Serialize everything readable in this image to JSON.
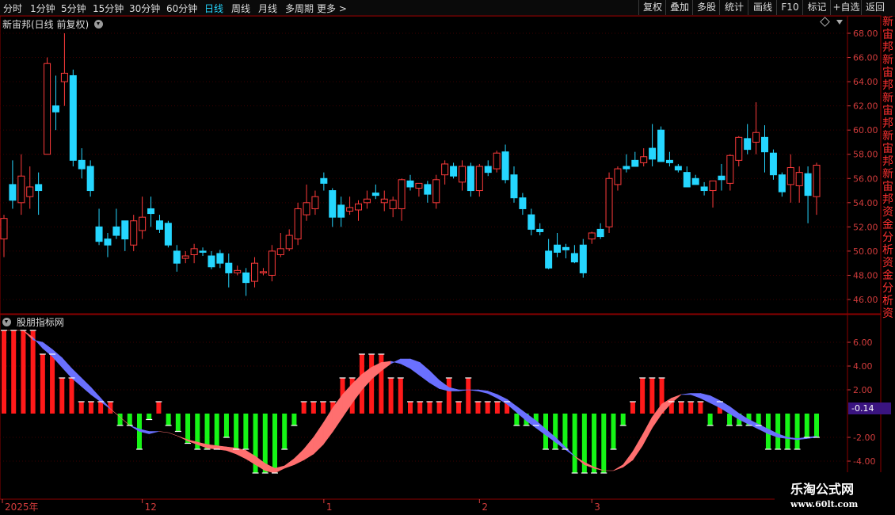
{
  "toolbar": {
    "tabs": [
      "分时",
      "1分钟",
      "5分钟",
      "15分钟",
      "30分钟",
      "60分钟",
      "日线",
      "周线",
      "月线",
      "多周期",
      "更多 >"
    ],
    "active_tab": "日线",
    "buttons": [
      "复权",
      "叠加",
      "多股",
      "统计",
      "画线",
      "F10",
      "标记",
      "+自选",
      "返回"
    ]
  },
  "price_panel": {
    "title": "新宙邦(日线 前复权)"
  },
  "indicator_panel": {
    "title": "股朋指标网",
    "current_value": "-0.14"
  },
  "watermark": {
    "line1": "乐淘公式网",
    "line2": "www.60lt.com"
  },
  "edge_glyphs": [
    "新",
    "宙",
    "邦",
    "新",
    "宙",
    "邦",
    "新",
    "宙",
    "邦",
    "新",
    "宙",
    "邦",
    "新",
    "宙",
    "邦",
    "资",
    "金",
    "分",
    "析",
    "资",
    "金",
    "分",
    "析",
    "资"
  ],
  "colors": {
    "up": "#ff3b3b",
    "down": "#25d6ff",
    "hist_pos": "#ff1a1a",
    "hist_neg": "#16f516",
    "ribbon_up": "#ff6f6f",
    "ribbon_down": "#6a70ff",
    "axis": "#8b0000",
    "axis_text": "#d23c3c"
  },
  "chart_data": [
    {
      "type": "candlestick",
      "title": "新宙邦(日线 前复权)",
      "ylim": [
        45.0,
        69.0
      ],
      "yticks": [
        "46.00",
        "48.00",
        "50.00",
        "52.00",
        "54.00",
        "56.00",
        "58.00",
        "60.00",
        "62.00",
        "64.00",
        "66.00",
        "68.00"
      ],
      "xticks": [
        "2025年",
        "12",
        "1",
        "2",
        "3"
      ],
      "xtick_index": [
        0,
        16,
        37,
        55,
        68
      ],
      "candles": [
        [
          51.0,
          53.0,
          49.5,
          52.7
        ],
        [
          55.5,
          57.5,
          53.5,
          54.2
        ],
        [
          54.0,
          58.0,
          53.0,
          56.2
        ],
        [
          54.5,
          57.0,
          53.5,
          55.3
        ],
        [
          55.5,
          56.5,
          53.0,
          55.0
        ],
        [
          58.0,
          66.0,
          58.0,
          65.5
        ],
        [
          62.0,
          64.5,
          60.0,
          61.5
        ],
        [
          64.0,
          68.0,
          62.0,
          64.7
        ],
        [
          64.5,
          65.0,
          57.0,
          57.5
        ],
        [
          57.5,
          58.5,
          56.0,
          56.8
        ],
        [
          57.0,
          57.5,
          54.5,
          55.0
        ],
        [
          52.0,
          53.5,
          50.5,
          50.8
        ],
        [
          51.0,
          51.5,
          49.5,
          50.5
        ],
        [
          52.0,
          53.5,
          51.0,
          51.3
        ],
        [
          52.5,
          52.5,
          50.0,
          51.0
        ],
        [
          50.5,
          53.0,
          50.0,
          52.5
        ],
        [
          51.7,
          54.5,
          51.0,
          52.8
        ],
        [
          53.5,
          54.5,
          52.0,
          53.1
        ],
        [
          52.5,
          53.0,
          51.5,
          51.8
        ],
        [
          52.3,
          52.5,
          50.3,
          50.5
        ],
        [
          50.0,
          50.5,
          48.3,
          49.0
        ],
        [
          49.4,
          50.0,
          49.0,
          49.6
        ],
        [
          49.7,
          50.6,
          49.0,
          50.2
        ],
        [
          50.0,
          50.3,
          49.6,
          49.9
        ],
        [
          49.6,
          50.0,
          48.5,
          48.7
        ],
        [
          49.8,
          50.1,
          48.6,
          49.0
        ],
        [
          49.0,
          49.8,
          47.0,
          48.2
        ],
        [
          48.2,
          48.8,
          48.0,
          48.4
        ],
        [
          48.2,
          48.6,
          46.3,
          47.4
        ],
        [
          47.5,
          49.5,
          47.0,
          49.0
        ],
        [
          48.2,
          48.6,
          48.0,
          48.3
        ],
        [
          48.0,
          50.5,
          47.5,
          50.0
        ],
        [
          49.7,
          51.5,
          49.5,
          50.2
        ],
        [
          50.2,
          51.8,
          50.0,
          51.3
        ],
        [
          51.0,
          54.0,
          50.5,
          53.5
        ],
        [
          53.0,
          55.5,
          52.5,
          54.0
        ],
        [
          53.5,
          55.0,
          53.0,
          54.5
        ],
        [
          56.0,
          56.5,
          55.0,
          55.6
        ],
        [
          55.0,
          55.2,
          52.0,
          52.8
        ],
        [
          53.8,
          54.5,
          52.0,
          52.8
        ],
        [
          53.3,
          54.5,
          53.0,
          53.6
        ],
        [
          53.4,
          54.2,
          52.5,
          53.9
        ],
        [
          54.0,
          55.0,
          53.5,
          54.3
        ],
        [
          54.8,
          55.5,
          54.3,
          54.6
        ],
        [
          54.0,
          55.0,
          53.3,
          54.3
        ],
        [
          53.5,
          54.5,
          52.8,
          54.2
        ],
        [
          53.5,
          56.0,
          52.5,
          55.9
        ],
        [
          55.8,
          56.3,
          55.0,
          55.3
        ],
        [
          55.2,
          55.6,
          54.5,
          55.6
        ],
        [
          55.5,
          55.8,
          54.0,
          54.7
        ],
        [
          54.0,
          56.3,
          53.5,
          55.9
        ],
        [
          56.3,
          57.5,
          55.5,
          57.2
        ],
        [
          57.0,
          57.3,
          56.0,
          56.2
        ],
        [
          55.7,
          57.5,
          55.0,
          57.0
        ],
        [
          57.0,
          57.3,
          54.5,
          55.0
        ],
        [
          55.0,
          57.2,
          54.5,
          57.0
        ],
        [
          57.0,
          57.5,
          56.2,
          56.5
        ],
        [
          56.8,
          58.3,
          56.5,
          58.1
        ],
        [
          58.2,
          58.8,
          55.6,
          55.9
        ],
        [
          56.3,
          57.0,
          54.0,
          54.4
        ],
        [
          54.4,
          54.8,
          53.0,
          53.5
        ],
        [
          53.0,
          53.5,
          51.3,
          51.8
        ],
        [
          51.8,
          52.3,
          51.3,
          51.6
        ],
        [
          50.0,
          51.0,
          48.5,
          48.6
        ],
        [
          50.5,
          51.5,
          49.5,
          49.9
        ],
        [
          50.3,
          50.6,
          49.4,
          50.1
        ],
        [
          49.8,
          50.5,
          49.0,
          49.1
        ],
        [
          50.5,
          51.0,
          47.8,
          48.2
        ],
        [
          51.0,
          51.6,
          50.6,
          51.5
        ],
        [
          51.8,
          52.3,
          51.0,
          51.2
        ],
        [
          52.0,
          56.5,
          51.5,
          56.0
        ],
        [
          55.5,
          57.0,
          55.0,
          56.8
        ],
        [
          57.0,
          58.0,
          56.5,
          56.8
        ],
        [
          57.5,
          58.2,
          57.0,
          57.0
        ],
        [
          57.3,
          58.5,
          57.0,
          57.8
        ],
        [
          58.5,
          60.5,
          57.0,
          57.6
        ],
        [
          60.0,
          60.3,
          57.5,
          57.4
        ],
        [
          57.5,
          58.2,
          57.0,
          57.3
        ],
        [
          57.0,
          57.2,
          56.5,
          56.7
        ],
        [
          56.5,
          57.0,
          55.5,
          55.3
        ],
        [
          56.0,
          56.3,
          55.5,
          55.5
        ],
        [
          55.3,
          55.7,
          54.6,
          55.0
        ],
        [
          55.0,
          55.8,
          53.6,
          55.8
        ],
        [
          56.2,
          57.2,
          55.0,
          55.9
        ],
        [
          55.6,
          58.0,
          55.0,
          57.9
        ],
        [
          57.5,
          59.5,
          57.0,
          59.4
        ],
        [
          59.3,
          60.5,
          58.0,
          58.4
        ],
        [
          59.0,
          62.3,
          58.0,
          59.8
        ],
        [
          59.4,
          60.4,
          56.5,
          58.2
        ],
        [
          58.1,
          58.4,
          55.9,
          56.3
        ],
        [
          56.3,
          56.5,
          54.5,
          54.9
        ],
        [
          55.5,
          58.0,
          54.0,
          56.9
        ],
        [
          55.4,
          57.0,
          54.0,
          56.5
        ],
        [
          56.4,
          57.0,
          52.3,
          54.6
        ],
        [
          54.5,
          57.3,
          53.0,
          57.1
        ]
      ]
    },
    {
      "type": "bar",
      "title": "股朋指标网",
      "ylim": [
        -6.5,
        7.0
      ],
      "yticks": [
        "6.00",
        "4.00",
        "2.00",
        "-2.00",
        "-4.00"
      ],
      "histogram": [
        7.0,
        7.0,
        7.0,
        7.0,
        5.0,
        5.0,
        3.0,
        3.0,
        1.0,
        1.0,
        1.0,
        1.0,
        -1.0,
        -1.0,
        -3.0,
        -0.5,
        1.0,
        -1.0,
        -1.5,
        -2.5,
        -3.0,
        -3.0,
        -3.0,
        -2.0,
        -3.0,
        -3.0,
        -5.0,
        -5.0,
        -5.0,
        -3.0,
        -1.0,
        1.0,
        1.0,
        1.0,
        1.0,
        3.0,
        3.0,
        5.0,
        5.0,
        5.0,
        3.0,
        3.0,
        1.0,
        1.0,
        1.0,
        1.0,
        3.0,
        1.0,
        3.0,
        1.0,
        1.0,
        1.0,
        1.0,
        -1.0,
        -1.0,
        -1.0,
        -3.0,
        -3.0,
        -3.0,
        -5.0,
        -5.0,
        -5.0,
        -5.0,
        -3.0,
        -1.0,
        1.0,
        3.0,
        3.0,
        3.0,
        1.0,
        1.0,
        1.0,
        1.0,
        -1.0,
        1.0,
        -1.0,
        -1.0,
        -1.0,
        -1.0,
        -3.0,
        -3.0,
        -3.0,
        -3.0,
        -2.0,
        -2.0
      ],
      "ribbon_fast": [
        7.0,
        7.0,
        7.0,
        6.4,
        5.5,
        4.8,
        3.9,
        3.0,
        2.3,
        1.6,
        1.0,
        0.4,
        -0.3,
        -1.0,
        -1.5,
        -1.7,
        -1.5,
        -1.6,
        -1.9,
        -2.2,
        -2.4,
        -2.6,
        -2.7,
        -2.8,
        -2.9,
        -3.1,
        -3.6,
        -4.2,
        -4.6,
        -4.4,
        -3.8,
        -3.0,
        -2.0,
        -0.8,
        0.5,
        1.6,
        2.5,
        3.3,
        3.9,
        4.3,
        4.4,
        4.2,
        3.8,
        3.2,
        2.6,
        2.1,
        1.9,
        1.9,
        2.0,
        1.9,
        1.7,
        1.3,
        0.8,
        0.1,
        -0.6,
        -1.2,
        -1.8,
        -2.4,
        -3.0,
        -3.6,
        -4.1,
        -4.5,
        -4.8,
        -4.8,
        -4.3,
        -3.2,
        -1.8,
        -0.3,
        0.8,
        1.3,
        1.6,
        1.6,
        1.3,
        0.9,
        0.5,
        0.0,
        -0.5,
        -0.9,
        -1.3,
        -1.7,
        -2.0,
        -2.1,
        -2.2,
        -2.1,
        -2.0
      ],
      "ribbon_slow": [
        7.0,
        7.0,
        7.0,
        6.2,
        6.0,
        5.4,
        4.7,
        3.8,
        3.0,
        2.2,
        1.3,
        0.4,
        -0.3,
        -1.0,
        -1.3,
        -1.5,
        -1.5,
        -1.6,
        -1.9,
        -2.3,
        -2.6,
        -2.9,
        -3.0,
        -3.1,
        -3.4,
        -3.8,
        -4.3,
        -4.8,
        -5.0,
        -4.6,
        -4.3,
        -3.9,
        -3.4,
        -2.6,
        -1.5,
        -0.3,
        0.9,
        2.0,
        2.9,
        3.6,
        4.2,
        4.6,
        4.6,
        4.3,
        3.6,
        2.8,
        2.2,
        2.0,
        2.0,
        2.0,
        1.9,
        1.6,
        1.2,
        0.6,
        0.0,
        -0.6,
        -1.3,
        -2.0,
        -2.8,
        -3.6,
        -4.3,
        -4.6,
        -4.8,
        -4.8,
        -4.5,
        -3.9,
        -2.7,
        -1.2,
        0.0,
        0.9,
        1.6,
        1.7,
        1.7,
        1.5,
        1.1,
        0.6,
        0.0,
        -0.5,
        -0.9,
        -1.3,
        -1.7,
        -2.0,
        -2.1,
        -2.0,
        -1.9
      ]
    }
  ]
}
